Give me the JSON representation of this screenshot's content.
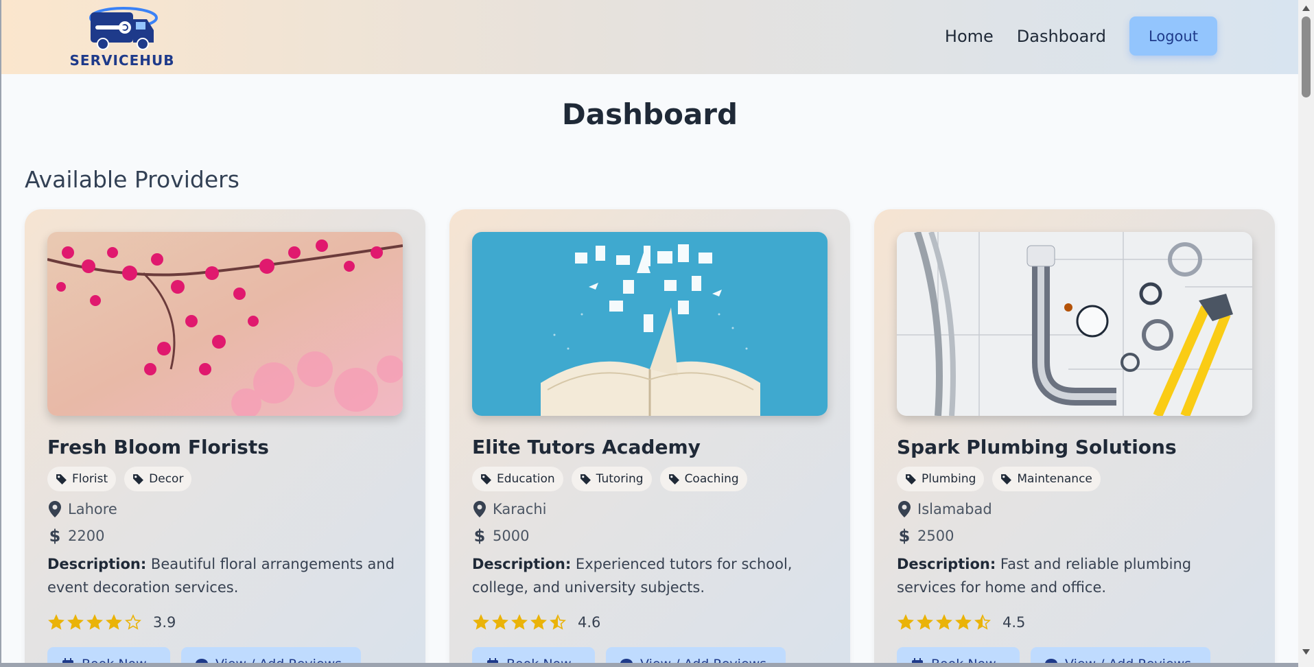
{
  "brand": {
    "name": "SERVICEHUB"
  },
  "nav": {
    "home": "Home",
    "dashboard": "Dashboard",
    "logout": "Logout"
  },
  "page": {
    "title": "Dashboard",
    "section": "Available Providers"
  },
  "colors": {
    "accent": "#93c5fd",
    "star": "#eab308",
    "brand": "#1e3a8a"
  },
  "providers": [
    {
      "name": "Fresh Bloom Florists",
      "tags": [
        "Florist",
        "Decor"
      ],
      "location": "Lahore",
      "price": "2200",
      "description_label": "Description:",
      "description": "Beautiful floral arrangements and event decoration services.",
      "rating": "3.9",
      "rating_value": 3.9,
      "image": "pink-blossom-photo",
      "book_label": "Book Now",
      "review_label": "View / Add Reviews"
    },
    {
      "name": "Elite Tutors Academy",
      "tags": [
        "Education",
        "Tutoring",
        "Coaching"
      ],
      "location": "Karachi",
      "price": "5000",
      "description_label": "Description:",
      "description": "Experienced tutors for school, college, and university subjects.",
      "rating": "4.6",
      "rating_value": 4.6,
      "image": "open-book-photo",
      "book_label": "Book Now",
      "review_label": "View / Add Reviews"
    },
    {
      "name": "Spark Plumbing Solutions",
      "tags": [
        "Plumbing",
        "Maintenance"
      ],
      "location": "Islamabad",
      "price": "2500",
      "description_label": "Description:",
      "description": "Fast and reliable plumbing services for home and office.",
      "rating": "4.5",
      "rating_value": 4.5,
      "image": "plumbing-tools-photo",
      "book_label": "Book Now",
      "review_label": "View / Add Reviews"
    }
  ]
}
